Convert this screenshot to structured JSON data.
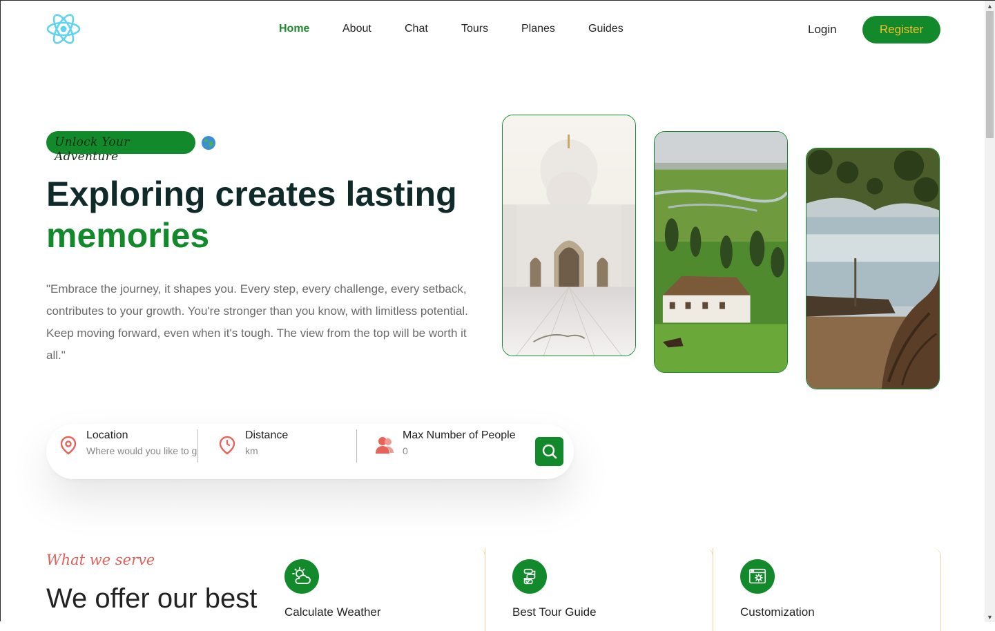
{
  "colors": {
    "brand_green": "#128a2c",
    "heading_dark": "#102a2a",
    "accent_gold": "#f2c12e",
    "accent_coral": "#e0605a"
  },
  "header": {
    "logo_icon": "react-atom-icon",
    "nav": [
      "Home",
      "About",
      "Chat",
      "Tours",
      "Planes",
      "Guides"
    ],
    "active_nav": "Home",
    "login_label": "Login",
    "register_label": "Register"
  },
  "hero": {
    "tagline": "Unlock Your Adventure",
    "tagline_icon": "globe-icon",
    "title_line1": "Exploring creates lasting",
    "title_line2": "memories",
    "quote": "\"Embrace the journey, it shapes you. Every step, every challenge, every setback, contributes to your growth. You're stronger than you know, with limitless potential. Keep moving forward, even when it's tough. The view from the top will be worth it all.\"",
    "photos": [
      "mosque-photo",
      "countryside-photo",
      "lake-photo"
    ]
  },
  "search": {
    "location_label": "Location",
    "location_placeholder": "Where would you like to go?",
    "distance_label": "Distance",
    "distance_placeholder": "km",
    "people_label": "Max Number of People",
    "people_placeholder": "0",
    "search_icon": "search-icon"
  },
  "services": {
    "subtitle": "What we serve",
    "title": "We offer our best",
    "items": [
      {
        "title": "Calculate Weather",
        "icon": "weather-icon"
      },
      {
        "title": "Best Tour Guide",
        "icon": "guide-icon"
      },
      {
        "title": "Customization",
        "icon": "customization-icon"
      }
    ]
  }
}
